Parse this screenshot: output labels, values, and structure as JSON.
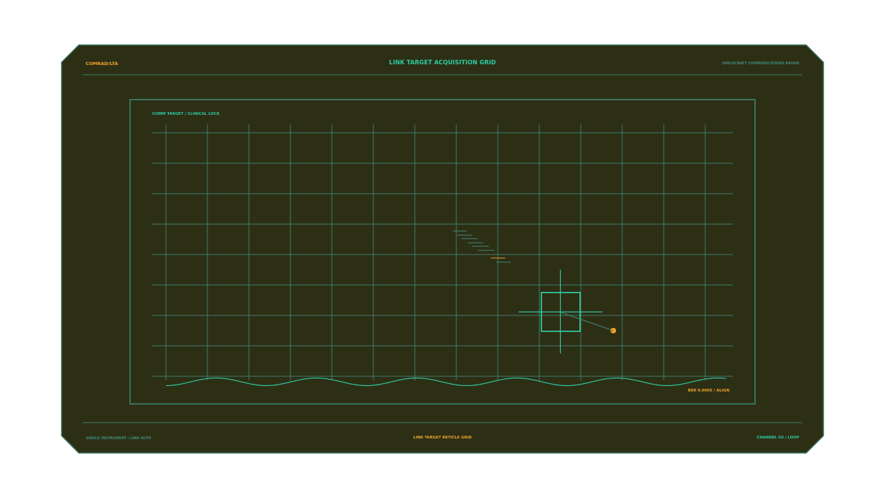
{
  "header": {
    "brand": "COMRAD/LTA",
    "title": "LINK TARGET ACQUISITION GRID",
    "subtitle": "SPACECRAFT COMMUNICATIONS RADAR"
  },
  "panel": {
    "label": "COMM TARGET / CLINICAL LOCK",
    "readout": "BER 0.0005 / ALIGN"
  },
  "footer": {
    "left": "SINGLE INSTRUMENT / LINK AUTH",
    "center": "LINK TARGET RETICLE GRID",
    "right": "CHANNEL 03 / LOOP"
  },
  "colors": {
    "frame_bg": "#2d2f15",
    "frame_stroke": "#3f7a63",
    "grid_line": "#3f7e6e",
    "accent_cyan": "#2fc9a3",
    "accent_amber": "#f0a32d",
    "muted_teal": "#3f8a7c"
  }
}
